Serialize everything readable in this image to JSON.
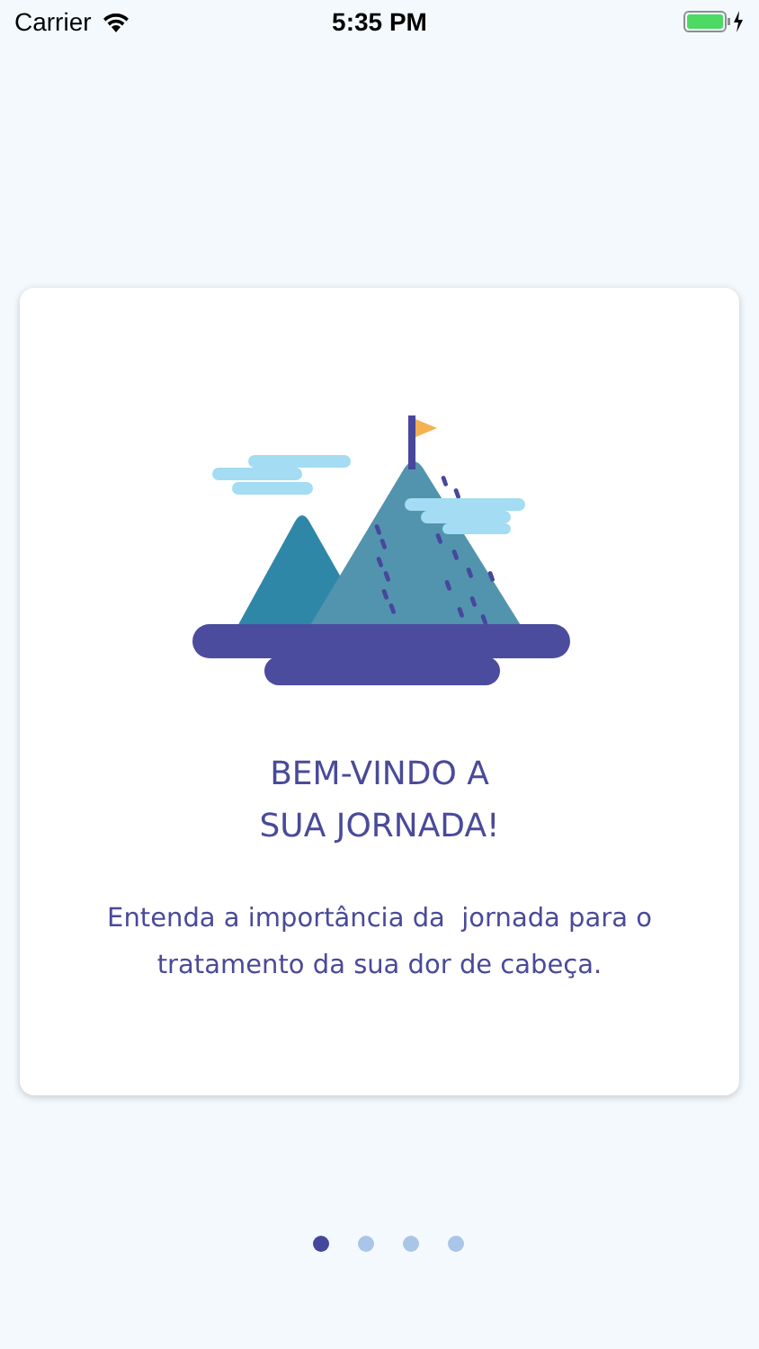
{
  "status_bar": {
    "carrier": "Carrier",
    "time": "5:35 PM"
  },
  "card": {
    "title_lines": [
      "BEM-VINDO A",
      "SUA JORNADA!"
    ],
    "description": "Entenda a importância da  jornada para o tratamento da sua dor de cabeça."
  },
  "pages": [
    {
      "selected": true
    },
    {
      "selected": false
    },
    {
      "selected": false
    },
    {
      "selected": false
    }
  ]
}
